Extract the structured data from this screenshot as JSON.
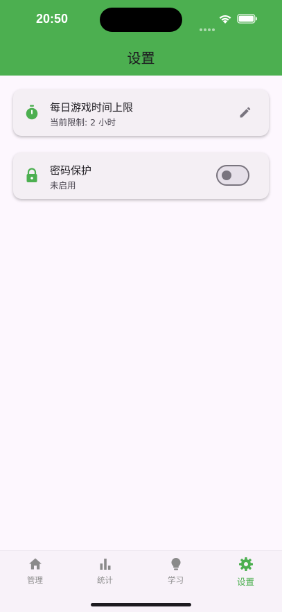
{
  "status_bar": {
    "time": "20:50",
    "wifi_icon": "wifi-icon",
    "battery_icon": "battery-icon"
  },
  "header": {
    "title": "设置",
    "color": "#4caf50"
  },
  "settings": [
    {
      "icon": "timer-icon",
      "title": "每日游戏时间上限",
      "subtitle": "当前限制: 2 小时",
      "action": "edit-icon"
    },
    {
      "icon": "lock-icon",
      "title": "密码保护",
      "subtitle": "未启用",
      "action": "toggle",
      "enabled": false
    }
  ],
  "nav": [
    {
      "label": "管理",
      "icon": "home-icon",
      "active": false
    },
    {
      "label": "统计",
      "icon": "bar-chart-icon",
      "active": false
    },
    {
      "label": "学习",
      "icon": "lightbulb-icon",
      "active": false
    },
    {
      "label": "设置",
      "icon": "gear-icon",
      "active": true
    }
  ],
  "colors": {
    "accent": "#4caf50",
    "background": "#fdf7fe",
    "card": "#f4eff4",
    "inactive": "#8a8a8a"
  }
}
